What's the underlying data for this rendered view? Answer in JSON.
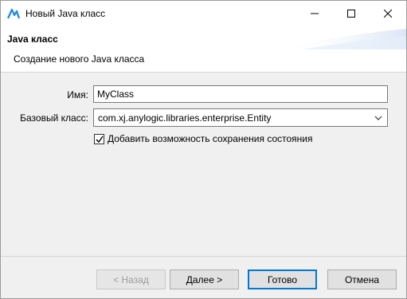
{
  "window": {
    "title": "Новый Java класс",
    "icon": "anylogic-icon"
  },
  "header": {
    "title": "Java класс",
    "subtitle": "Создание нового Java класса"
  },
  "form": {
    "name_label": "Имя:",
    "name_value": "MyClass",
    "base_label": "Базовый класс:",
    "base_value": "com.xj.anylogic.libraries.enterprise.Entity",
    "checkbox_label": "Добавить возможность сохранения состояния",
    "checkbox_checked": true
  },
  "buttons": {
    "back": "< Назад",
    "next": "Далее >",
    "finish": "Готово",
    "cancel": "Отмена"
  },
  "colors": {
    "accent": "#0078d7",
    "icon_blue": "#1e88e5"
  }
}
